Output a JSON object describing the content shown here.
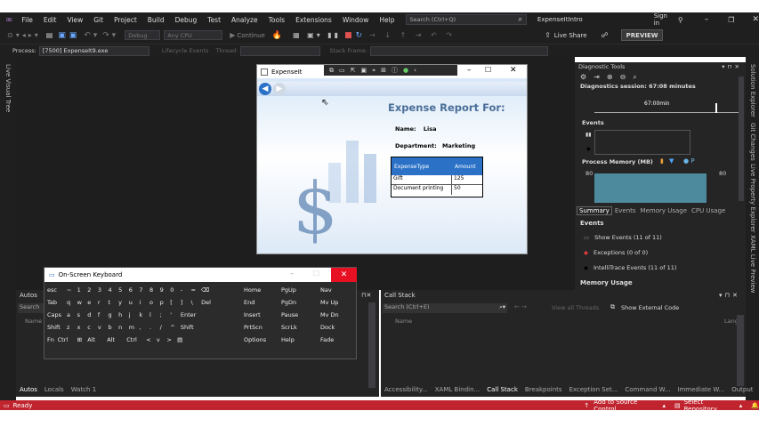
{
  "menu": [
    "File",
    "Edit",
    "View",
    "Git",
    "Project",
    "Build",
    "Debug",
    "Test",
    "Analyze",
    "Tools",
    "Extensions",
    "Window",
    "Help"
  ],
  "search_placeholder": "Search (Ctrl+Q)",
  "solution_name": "ExpenseItIntro",
  "sign_in": "Sign in",
  "toolbar": {
    "config": "Debug",
    "platform": "Any CPU",
    "continue": "Continue",
    "live_share": "Live Share",
    "preview": "PREVIEW"
  },
  "procbar": {
    "process_label": "Process:",
    "process_value": "[7500] ExpenseIt9.exe",
    "lifecycle": "Lifecycle Events",
    "thread": "Thread:",
    "stack_frame": "Stack Frame:"
  },
  "left_strip": "Live Visual Tree",
  "right_strip": [
    "Solution Explorer",
    "Git Changes",
    "Live Property Explorer",
    "XAML Live Preview"
  ],
  "app": {
    "title": "ExpenseIt",
    "header": "Expense Report For:",
    "name_label": "Name:",
    "name_value": "Lisa",
    "dept_label": "Department:",
    "dept_value": "Marketing",
    "columns": [
      "ExpenseType",
      "Amount"
    ],
    "rows": [
      [
        "Gift",
        "125"
      ],
      [
        "Document printing",
        "50"
      ]
    ]
  },
  "diag": {
    "title": "Diagnostic Tools",
    "session": "Diagnostics session: 67:08 minutes",
    "time": "67:00min",
    "events": "Events",
    "memory": "Process Memory (MB)",
    "mem_value": "80",
    "mem_value2": "80",
    "tabs": [
      "Summary",
      "Events",
      "Memory Usage",
      "CPU Usage"
    ],
    "summary_events": "Events",
    "items": [
      "Show Events (11 of 11)",
      "Exceptions (0 of 0)",
      "IntelliTrace Events (11 of 11)"
    ],
    "memory_usage": "Memory Usage"
  },
  "osk": {
    "title": "On-Screen Keyboard",
    "rows": [
      [
        "esc",
        "~",
        "1",
        "2",
        "3",
        "4",
        "5",
        "6",
        "7",
        "8",
        "9",
        "0",
        "-",
        "=",
        "⌫"
      ],
      [
        "Tab",
        "q",
        "w",
        "e",
        "r",
        "t",
        "y",
        "u",
        "i",
        "o",
        "p",
        "[",
        "]",
        "\\",
        "Del"
      ],
      [
        "Caps",
        "a",
        "s",
        "d",
        "f",
        "g",
        "h",
        "j",
        "k",
        "l",
        ";",
        "'",
        "Enter"
      ],
      [
        "Shift",
        "z",
        "x",
        "c",
        "v",
        "b",
        "n",
        "m",
        ",",
        ".",
        "/",
        "^",
        "Shift"
      ],
      [
        "Fn",
        "Ctrl",
        "⊞",
        "Alt",
        "Alt",
        "Ctrl",
        "<",
        "v",
        ">",
        "▤"
      ]
    ],
    "nav": [
      [
        "Home",
        "PgUp",
        "Nav"
      ],
      [
        "End",
        "PgDn",
        "Mv Up"
      ],
      [
        "Insert",
        "Pause",
        "Mv Dn"
      ],
      [
        "PrtScn",
        "ScrLk",
        "Dock"
      ],
      [
        "Options",
        "Help",
        "Fade"
      ]
    ]
  },
  "autos": {
    "title": "Autos",
    "search": "Search",
    "col": "Name",
    "tabs": [
      "Autos",
      "Locals",
      "Watch 1"
    ]
  },
  "callstack": {
    "title": "Call Stack",
    "search": "Search (Ctrl+E)",
    "view_threads": "View all Threads",
    "show_external": "Show External Code",
    "col_name": "Name",
    "col_lang": "Lang",
    "tabs": [
      "Accessibility...",
      "XAML Bindin...",
      "Call Stack",
      "Breakpoints",
      "Exception Set...",
      "Command W...",
      "Immediate W...",
      "Output"
    ]
  },
  "status": {
    "ready": "Ready",
    "add_source": "Add to Source Control",
    "select_repo": "Select Repository"
  },
  "colors": {
    "vs_bg": "#1f1f1f",
    "status_red": "#c0252f",
    "accent_blue": "#2b72c7",
    "close_red": "#e81123"
  }
}
